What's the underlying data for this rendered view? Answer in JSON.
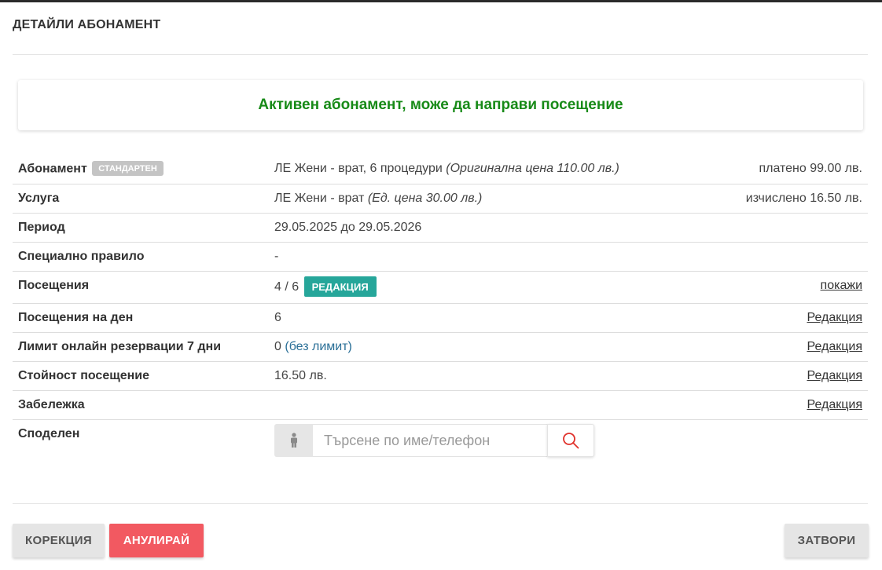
{
  "modal": {
    "title": "ДЕТАЙЛИ АБОНАМЕНТ"
  },
  "status": {
    "message": "Активен абонамент, може да направи посещение",
    "color": "#178a17"
  },
  "details": {
    "subscription": {
      "label": "Абонамент",
      "badge": "СТАНДАРТЕН",
      "value": "ЛЕ Жени - врат, 6 процедури",
      "value_note": "(Оригинална цена 110.00 лв.)",
      "right": "платено 99.00 лв."
    },
    "service": {
      "label": "Услуга",
      "value": "ЛЕ Жени - врат",
      "value_note": "(Ед. цена 30.00 лв.)",
      "right": "изчислено 16.50 лв."
    },
    "period": {
      "label": "Период",
      "value": "29.05.2025 до 29.05.2026"
    },
    "special_rule": {
      "label": "Специално правило",
      "value": "-"
    },
    "visits": {
      "label": "Посещения",
      "value": "4 / 6",
      "edit_button": "РЕДАКЦИЯ",
      "right_link": "покажи"
    },
    "visits_per_day": {
      "label": "Посещения на ден",
      "value": "6",
      "right_link": "Редакция"
    },
    "online_limit": {
      "label": "Лимит онлайн резервации 7 дни",
      "value": "0",
      "value_note": "(без лимит)",
      "right_link": "Редакция"
    },
    "visit_value": {
      "label": "Стойност посещение",
      "value": "16.50 лв.",
      "right_link": "Редакция"
    },
    "note": {
      "label": "Забележка",
      "value": "",
      "right_link": "Редакция"
    },
    "shared": {
      "label": "Споделен",
      "search_placeholder": "Търсене по име/телефон"
    }
  },
  "footer": {
    "correction": "КОРЕКЦИЯ",
    "cancel": "АНУЛИРАЙ",
    "close": "ЗАТВОРИ"
  },
  "icons": {
    "person": "person-icon",
    "search": "search-icon"
  },
  "colors": {
    "cancel": "#f25961",
    "edit_button": "#26a69a",
    "badge": "#c4c4c4",
    "search_icon": "#e0302a"
  }
}
